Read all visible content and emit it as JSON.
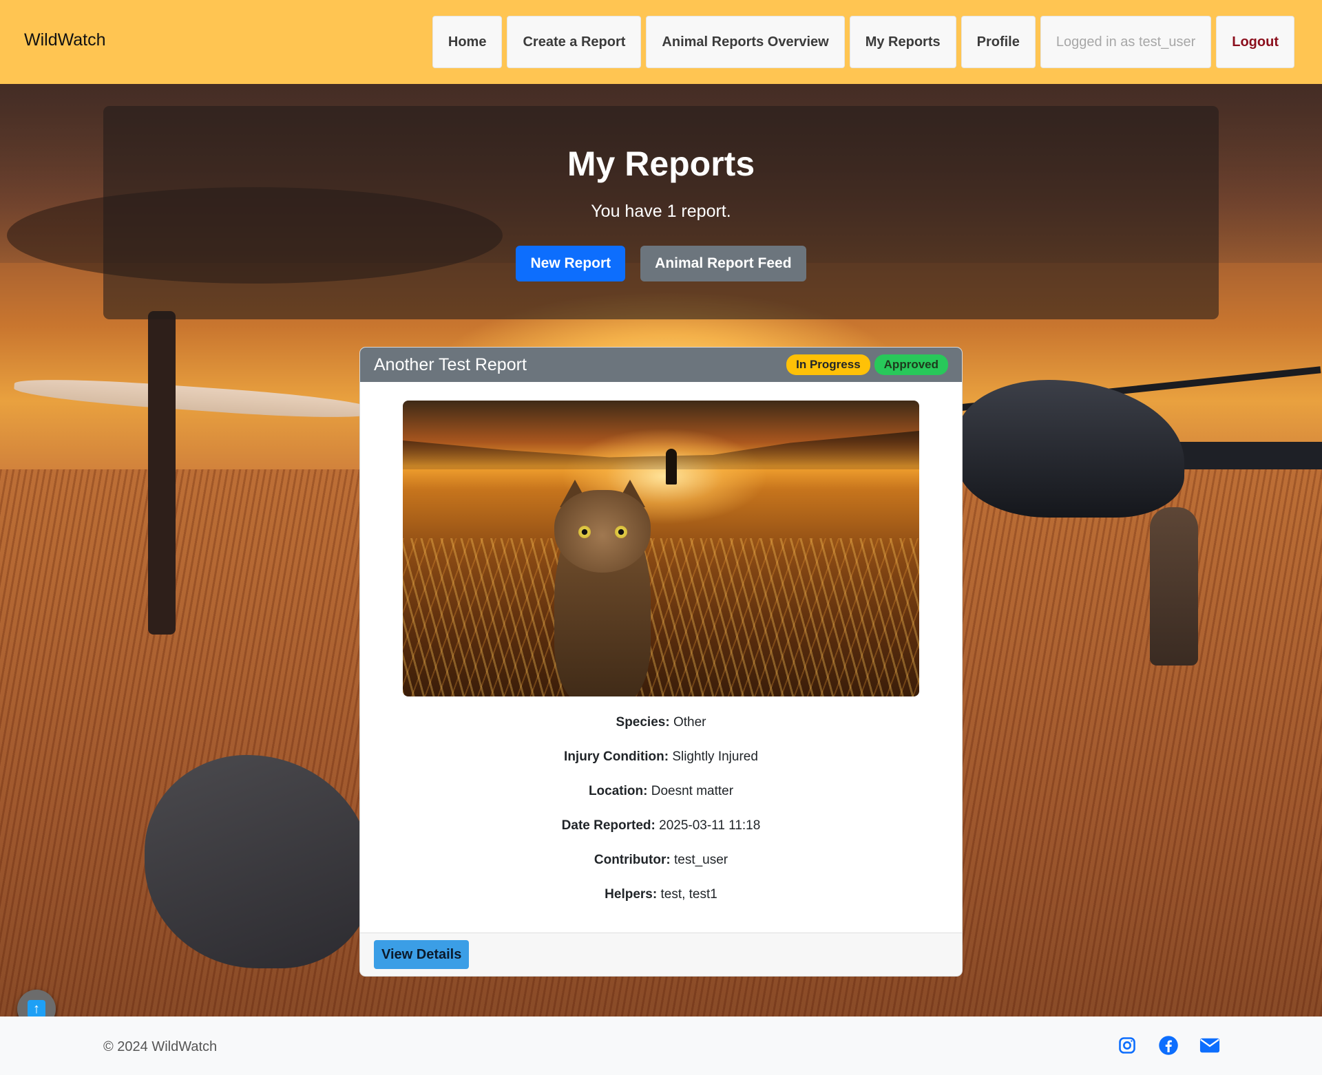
{
  "brand": "WildWatch",
  "nav": {
    "home": "Home",
    "create_report": "Create a Report",
    "overview": "Animal Reports Overview",
    "my_reports": "My Reports",
    "profile": "Profile",
    "logged_in": "Logged in as test_user",
    "logout": "Logout"
  },
  "hero": {
    "title": "My Reports",
    "subtitle": "You have 1 report.",
    "new_report": "New Report",
    "feed": "Animal Report Feed"
  },
  "report": {
    "title": "Another Test Report",
    "badges": {
      "status": "In Progress",
      "approval": "Approved"
    },
    "fields": [
      {
        "label": "Species:",
        "value": "Other"
      },
      {
        "label": "Injury Condition:",
        "value": "Slightly Injured"
      },
      {
        "label": "Location:",
        "value": "Doesnt matter"
      },
      {
        "label": "Date Reported:",
        "value": "2025-03-11 11:18"
      },
      {
        "label": "Contributor:",
        "value": "test_user"
      },
      {
        "label": "Helpers:",
        "value": "test, test1"
      }
    ],
    "view_details": "View Details"
  },
  "footer": {
    "copyright": "© 2024 WildWatch",
    "social": [
      "instagram-icon",
      "facebook-icon",
      "envelope-icon"
    ]
  },
  "colors": {
    "navbar": "#ffc552",
    "primary": "#0d6efd",
    "secondary": "#6c757d",
    "warning": "#ffc107",
    "success": "#28c85a",
    "logout": "#8b0f1d"
  }
}
